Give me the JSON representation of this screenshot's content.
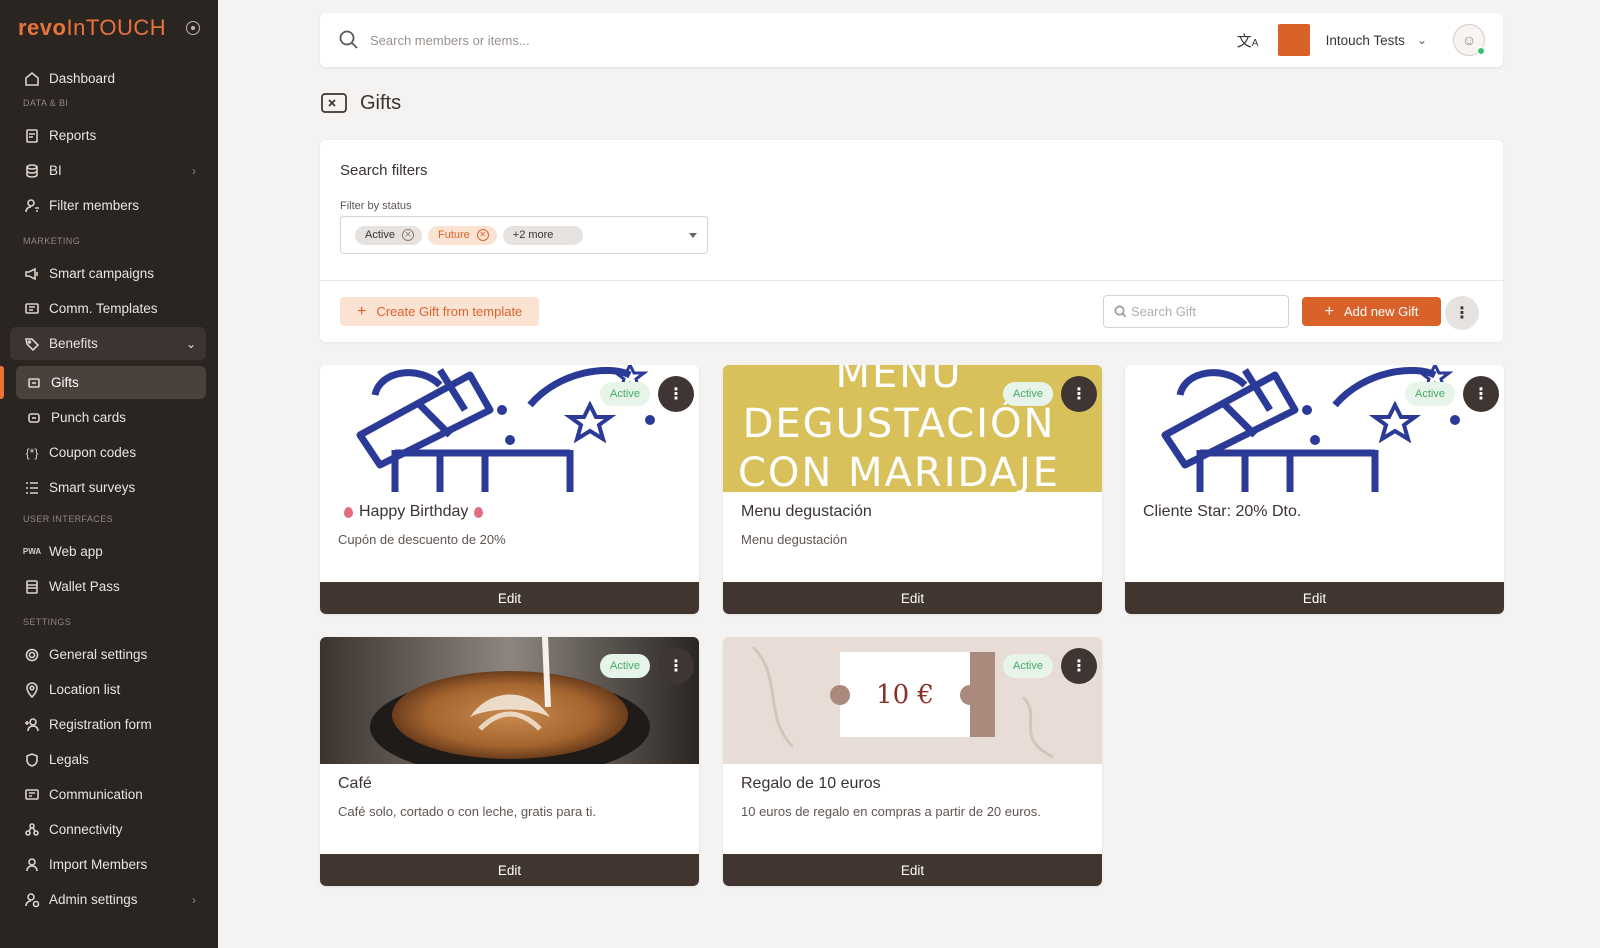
{
  "brand": {
    "logo_bold": "revo",
    "logo_light": "InTOUCH"
  },
  "nav": {
    "dashboard": "Dashboard",
    "section_data": "DATA & BI",
    "reports": "Reports",
    "bi": "BI",
    "filter_members": "Filter members",
    "section_marketing": "MARKETING",
    "smart_campaigns": "Smart campaigns",
    "comm_templates": "Comm. Templates",
    "benefits": "Benefits",
    "gifts": "Gifts",
    "punch_cards": "Punch cards",
    "coupon_codes": "Coupon codes",
    "smart_surveys": "Smart surveys",
    "section_ui": "USER INTERFACES",
    "web_app": "Web app",
    "wallet_pass": "Wallet Pass",
    "section_settings": "SETTINGS",
    "general_settings": "General settings",
    "location_list": "Location list",
    "registration_form": "Registration form",
    "legals": "Legals",
    "communication": "Communication",
    "connectivity": "Connectivity",
    "import_members": "Import Members",
    "admin_settings": "Admin settings"
  },
  "topbar": {
    "search_placeholder": "Search members or items...",
    "org_name": "Intouch Tests",
    "translate_icon": "translate-icon"
  },
  "page": {
    "title": "Gifts"
  },
  "filters": {
    "heading": "Search filters",
    "status_label": "Filter by status",
    "chips": [
      "Active",
      "Future",
      "+2 more"
    ],
    "create_template_label": "Create Gift from template",
    "search_gift_placeholder": "Search Gift",
    "add_new_label": "Add new Gift"
  },
  "gifts": [
    {
      "title": "Happy Birthday",
      "description": "Cupón de descuento de 20%",
      "status": "Active",
      "edit": "Edit",
      "image": "gift-box-illustration"
    },
    {
      "title": "Menu degustación",
      "description": "Menu degustación",
      "status": "Active",
      "edit": "Edit",
      "image": "menu-banner",
      "image_text": [
        "MENU",
        "DEGUSTACIÓN",
        "CON MARIDAJE"
      ]
    },
    {
      "title": "Cliente Star: 20% Dto.",
      "description": "",
      "status": "Active",
      "edit": "Edit",
      "image": "gift-box-illustration"
    },
    {
      "title": "Café",
      "description": "Café solo, cortado o con leche, gratis para ti.",
      "status": "Active",
      "edit": "Edit",
      "image": "latte-photo"
    },
    {
      "title": "Regalo de 10 euros",
      "description": "10 euros de regalo en compras a partir de 20 euros.",
      "status": "Active",
      "edit": "Edit",
      "image": "voucher",
      "image_text": "10 €"
    }
  ],
  "colors": {
    "accent": "#d9622b",
    "sidebar": "#2b2522",
    "active_badge": "#47a866",
    "illustration_blue": "#2b3a97",
    "menu_yellow": "#d8c05b"
  }
}
